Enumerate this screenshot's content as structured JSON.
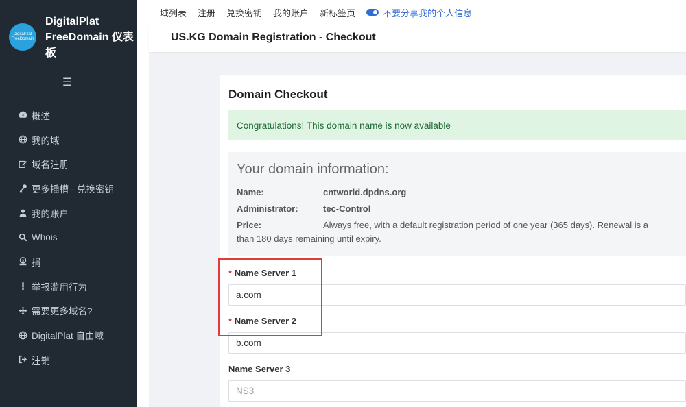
{
  "sidebar": {
    "logo_line1": "DigitalPlat",
    "logo_line2": "FreeDomain",
    "brand_title": "DigitalPlat FreeDomain 仪表板",
    "menu_icon": "hamburger-icon",
    "items": [
      {
        "label": "概述",
        "icon": "dashboard-icon"
      },
      {
        "label": "我的域",
        "icon": "globe-icon"
      },
      {
        "label": "域名注册",
        "icon": "edit-icon"
      },
      {
        "label": "更多插槽 - 兑换密钥",
        "icon": "key-icon"
      },
      {
        "label": "我的账户",
        "icon": "user-icon"
      },
      {
        "label": "Whois",
        "icon": "search-icon"
      },
      {
        "label": "捐",
        "icon": "donate-icon"
      },
      {
        "label": "举报滥用行为",
        "icon": "exclamation-icon"
      },
      {
        "label": "需要更多域名?",
        "icon": "arrows-icon"
      },
      {
        "label": "DigitalPlat 自由域",
        "icon": "globe-icon"
      },
      {
        "label": "注销",
        "icon": "sign-out-icon"
      }
    ]
  },
  "topnav": {
    "items": [
      "域列表",
      "注册",
      "兑换密钥",
      "我的账户",
      "新标签页"
    ],
    "privacy": "不要分享我的个人信息"
  },
  "page": {
    "title": "US.KG Domain Registration - Checkout"
  },
  "checkout": {
    "title": "Domain Checkout",
    "alert": "Congratulations! This domain name is now available",
    "info_title": "Your domain information:",
    "name_label": "Name:",
    "name_value": "cntworld.dpdns.org",
    "admin_label": "Administrator:",
    "admin_value": "tec-Control",
    "price_label": "Price:",
    "price_value": "Always free, with a default registration period of one year (365 days). Renewal is a",
    "price_value_cont": "than 180 days remaining until expiry.",
    "ns1_label": "Name Server 1",
    "ns1_value": "a.com",
    "ns2_label": "Name Server 2",
    "ns2_value": "b.com",
    "ns3_label": "Name Server 3",
    "ns3_placeholder": "NS3",
    "required_mark": "*"
  },
  "colors": {
    "sidebar_bg": "#212a33",
    "accent": "#2f6ad9",
    "alert_bg": "#dff4e3",
    "highlight": "#e03c3c"
  }
}
